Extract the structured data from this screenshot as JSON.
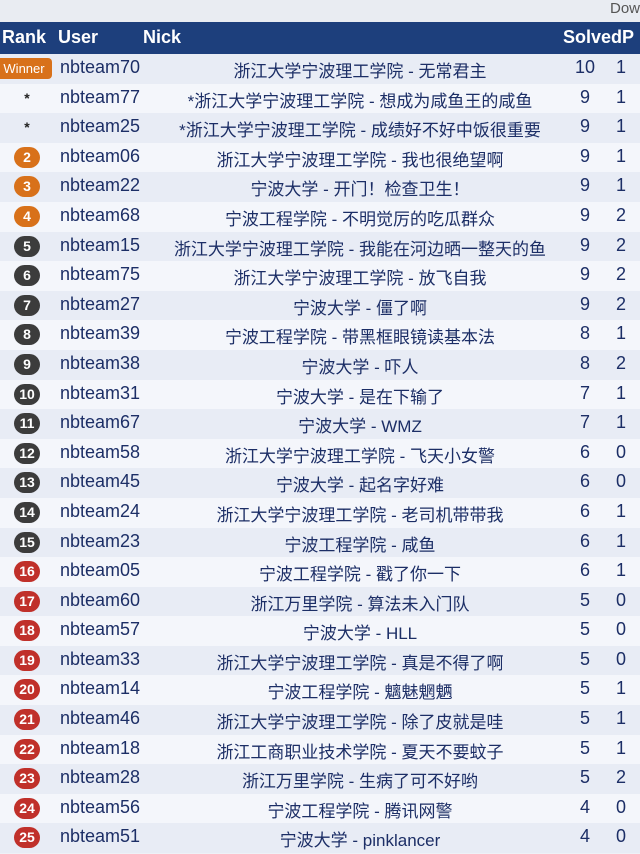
{
  "header": {
    "download_label": "Dow",
    "rank": "Rank",
    "user": "User",
    "nick": "Nick",
    "solved": "SolvedP"
  },
  "colors": {
    "header_bg": "#1d3f7c",
    "gold": "#d8711a",
    "dark": "#3c3c3c",
    "red": "#c0302a"
  },
  "rows": [
    {
      "rank": "Winner",
      "user": "nbteam70",
      "nick": "浙江大学宁波理工学院 - 无常君主",
      "solved": "10",
      "pen": "1",
      "style": "winner"
    },
    {
      "rank": "*",
      "user": "nbteam77",
      "nick": "*浙江大学宁波理工学院 - 想成为咸鱼王的咸鱼",
      "solved": "9",
      "pen": "1",
      "style": "star"
    },
    {
      "rank": "*",
      "user": "nbteam25",
      "nick": "*浙江大学宁波理工学院 - 成绩好不好中饭很重要",
      "solved": "9",
      "pen": "1",
      "style": "star"
    },
    {
      "rank": "2",
      "user": "nbteam06",
      "nick": "浙江大学宁波理工学院 - 我也很绝望啊",
      "solved": "9",
      "pen": "1",
      "style": "gold"
    },
    {
      "rank": "3",
      "user": "nbteam22",
      "nick": "宁波大学 - 开门！检查卫生！",
      "solved": "9",
      "pen": "1",
      "style": "gold"
    },
    {
      "rank": "4",
      "user": "nbteam68",
      "nick": "宁波工程学院 - 不明觉厉的吃瓜群众",
      "solved": "9",
      "pen": "2",
      "style": "gold"
    },
    {
      "rank": "5",
      "user": "nbteam15",
      "nick": "浙江大学宁波理工学院 - 我能在河边晒一整天的鱼",
      "solved": "9",
      "pen": "2",
      "style": "dark"
    },
    {
      "rank": "6",
      "user": "nbteam75",
      "nick": "浙江大学宁波理工学院 - 放飞自我",
      "solved": "9",
      "pen": "2",
      "style": "dark"
    },
    {
      "rank": "7",
      "user": "nbteam27",
      "nick": "宁波大学 - 僵了啊",
      "solved": "9",
      "pen": "2",
      "style": "dark"
    },
    {
      "rank": "8",
      "user": "nbteam39",
      "nick": "宁波工程学院 - 带黑框眼镜读基本法",
      "solved": "8",
      "pen": "1",
      "style": "dark"
    },
    {
      "rank": "9",
      "user": "nbteam38",
      "nick": "宁波大学 - 吓人",
      "solved": "8",
      "pen": "2",
      "style": "dark"
    },
    {
      "rank": "10",
      "user": "nbteam31",
      "nick": "宁波大学 - 是在下输了",
      "solved": "7",
      "pen": "1",
      "style": "dark"
    },
    {
      "rank": "11",
      "user": "nbteam67",
      "nick": "宁波大学 - WMZ",
      "solved": "7",
      "pen": "1",
      "style": "dark"
    },
    {
      "rank": "12",
      "user": "nbteam58",
      "nick": "浙江大学宁波理工学院 - 飞天小女警",
      "solved": "6",
      "pen": "0",
      "style": "dark"
    },
    {
      "rank": "13",
      "user": "nbteam45",
      "nick": "宁波大学 - 起名字好难",
      "solved": "6",
      "pen": "0",
      "style": "dark"
    },
    {
      "rank": "14",
      "user": "nbteam24",
      "nick": "浙江大学宁波理工学院 - 老司机带带我",
      "solved": "6",
      "pen": "1",
      "style": "dark"
    },
    {
      "rank": "15",
      "user": "nbteam23",
      "nick": "宁波工程学院 - 咸鱼",
      "solved": "6",
      "pen": "1",
      "style": "dark"
    },
    {
      "rank": "16",
      "user": "nbteam05",
      "nick": "宁波工程学院 - 戳了你一下",
      "solved": "6",
      "pen": "1",
      "style": "red"
    },
    {
      "rank": "17",
      "user": "nbteam60",
      "nick": "浙江万里学院 - 算法未入门队",
      "solved": "5",
      "pen": "0",
      "style": "red"
    },
    {
      "rank": "18",
      "user": "nbteam57",
      "nick": "宁波大学 - HLL",
      "solved": "5",
      "pen": "0",
      "style": "red"
    },
    {
      "rank": "19",
      "user": "nbteam33",
      "nick": "浙江大学宁波理工学院 - 真是不得了啊",
      "solved": "5",
      "pen": "0",
      "style": "red"
    },
    {
      "rank": "20",
      "user": "nbteam14",
      "nick": "宁波工程学院 - 魑魅魍魉",
      "solved": "5",
      "pen": "1",
      "style": "red"
    },
    {
      "rank": "21",
      "user": "nbteam46",
      "nick": "浙江大学宁波理工学院 - 除了皮就是哇",
      "solved": "5",
      "pen": "1",
      "style": "red"
    },
    {
      "rank": "22",
      "user": "nbteam18",
      "nick": "浙江工商职业技术学院 - 夏天不要蚊子",
      "solved": "5",
      "pen": "1",
      "style": "red"
    },
    {
      "rank": "23",
      "user": "nbteam28",
      "nick": "浙江万里学院 - 生病了可不好哟",
      "solved": "5",
      "pen": "2",
      "style": "red"
    },
    {
      "rank": "24",
      "user": "nbteam56",
      "nick": "宁波工程学院 - 腾讯网警",
      "solved": "4",
      "pen": "0",
      "style": "red"
    },
    {
      "rank": "25",
      "user": "nbteam51",
      "nick": "宁波大学 - pinklancer",
      "solved": "4",
      "pen": "0",
      "style": "red"
    }
  ]
}
